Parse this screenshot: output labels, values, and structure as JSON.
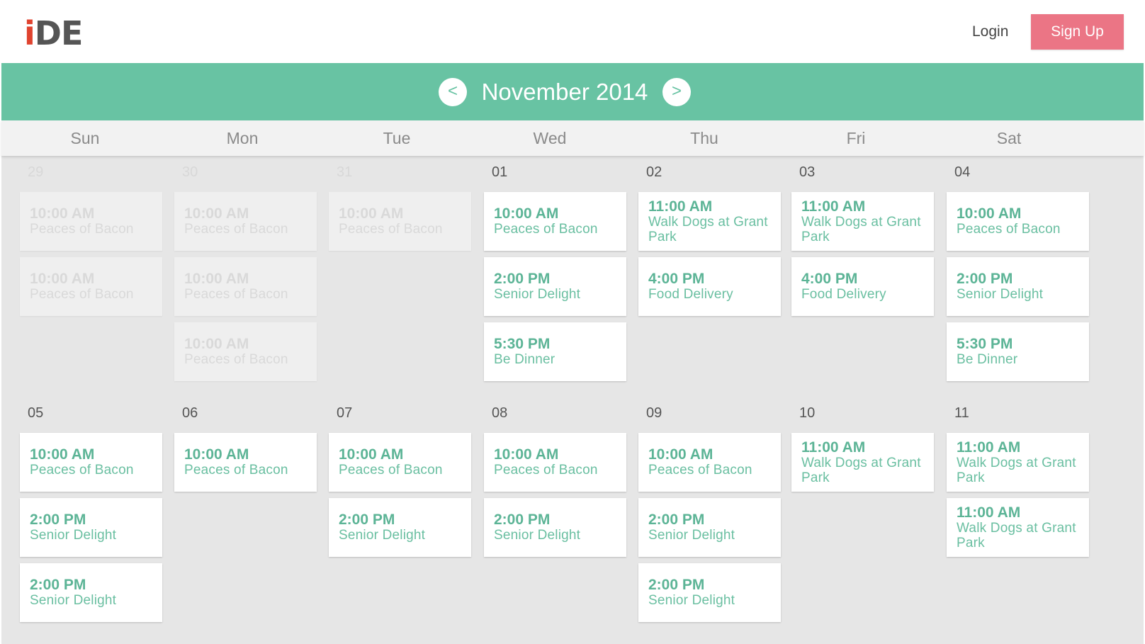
{
  "header": {
    "logo_i": "i",
    "logo_rest": "DE",
    "login_label": "Login",
    "signup_label": "Sign Up"
  },
  "calendar": {
    "month_label": "November 2014",
    "prev_label": "<",
    "next_label": ">",
    "weekdays": [
      "Sun",
      "Mon",
      "Tue",
      "Wed",
      "Thu",
      "Fri",
      "Sat"
    ],
    "weeks": [
      {
        "days": [
          {
            "num": "29",
            "faded": true,
            "events": [
              {
                "time": "10:00 AM",
                "name": "Peaces of Bacon"
              },
              {
                "time": "10:00 AM",
                "name": "Peaces of Bacon"
              }
            ]
          },
          {
            "num": "30",
            "faded": true,
            "events": [
              {
                "time": "10:00 AM",
                "name": "Peaces of Bacon"
              },
              {
                "time": "10:00 AM",
                "name": "Peaces of Bacon"
              },
              {
                "time": "10:00 AM",
                "name": "Peaces of Bacon"
              }
            ]
          },
          {
            "num": "31",
            "faded": true,
            "events": [
              {
                "time": "10:00 AM",
                "name": "Peaces of Bacon"
              }
            ]
          },
          {
            "num": "01",
            "faded": false,
            "events": [
              {
                "time": "10:00 AM",
                "name": "Peaces of Bacon"
              },
              {
                "time": "2:00 PM",
                "name": "Senior Delight"
              },
              {
                "time": "5:30 PM",
                "name": "Be Dinner"
              }
            ]
          },
          {
            "num": "02",
            "faded": false,
            "events": [
              {
                "time": "11:00 AM",
                "name": "Walk Dogs at Grant Park"
              },
              {
                "time": "4:00 PM",
                "name": "Food Delivery"
              }
            ]
          },
          {
            "num": "03",
            "faded": false,
            "events": [
              {
                "time": "11:00 AM",
                "name": "Walk Dogs at Grant Park"
              },
              {
                "time": "4:00 PM",
                "name": "Food Delivery"
              }
            ]
          },
          {
            "num": "04",
            "faded": false,
            "events": [
              {
                "time": "10:00 AM",
                "name": "Peaces of Bacon"
              },
              {
                "time": "2:00 PM",
                "name": "Senior Delight"
              },
              {
                "time": "5:30 PM",
                "name": "Be Dinner"
              }
            ]
          }
        ]
      },
      {
        "days": [
          {
            "num": "05",
            "faded": false,
            "events": [
              {
                "time": "10:00 AM",
                "name": "Peaces of Bacon"
              },
              {
                "time": "2:00 PM",
                "name": "Senior Delight"
              },
              {
                "time": "2:00 PM",
                "name": "Senior Delight"
              }
            ]
          },
          {
            "num": "06",
            "faded": false,
            "events": [
              {
                "time": "10:00 AM",
                "name": "Peaces of Bacon"
              }
            ]
          },
          {
            "num": "07",
            "faded": false,
            "events": [
              {
                "time": "10:00 AM",
                "name": "Peaces of Bacon"
              },
              {
                "time": "2:00 PM",
                "name": "Senior Delight"
              }
            ]
          },
          {
            "num": "08",
            "faded": false,
            "events": [
              {
                "time": "10:00 AM",
                "name": "Peaces of Bacon"
              },
              {
                "time": "2:00 PM",
                "name": "Senior Delight"
              }
            ]
          },
          {
            "num": "09",
            "faded": false,
            "events": [
              {
                "time": "10:00 AM",
                "name": "Peaces of Bacon"
              },
              {
                "time": "2:00 PM",
                "name": "Senior Delight"
              },
              {
                "time": "2:00 PM",
                "name": "Senior Delight"
              }
            ]
          },
          {
            "num": "10",
            "faded": false,
            "events": [
              {
                "time": "11:00 AM",
                "name": "Walk Dogs at Grant Park"
              }
            ]
          },
          {
            "num": "11",
            "faded": false,
            "events": [
              {
                "time": "11:00 AM",
                "name": "Walk Dogs at Grant Park"
              },
              {
                "time": "11:00 AM",
                "name": "Walk Dogs at Grant Park"
              }
            ]
          }
        ]
      }
    ]
  },
  "colors": {
    "accent_green": "#68c3a3",
    "signup_pink": "#eb7585",
    "logo_red": "#e0432f",
    "grid_background": "#e6e6e6"
  }
}
